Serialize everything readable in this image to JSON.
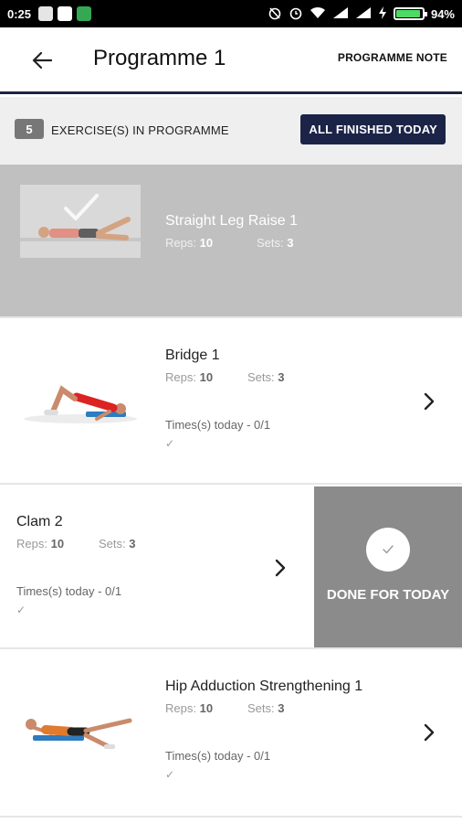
{
  "status_bar": {
    "time": "0:25",
    "battery": "94%",
    "battery_level": 0.94
  },
  "header": {
    "back_icon": "arrow-left-icon",
    "title": "Programme 1",
    "note_button": "PROGRAMME NOTE"
  },
  "summary": {
    "count": "5",
    "count_label": "EXERCISE(S) IN PROGRAMME",
    "finish_button": "ALL FINISHED TODAY"
  },
  "exercises": [
    {
      "name": "Straight Leg Raise 1",
      "reps_label": "Reps:",
      "reps": "10",
      "sets_label": "Sets:",
      "sets": "3",
      "state": "completed"
    },
    {
      "name": "Bridge 1",
      "reps_label": "Reps:",
      "reps": "10",
      "sets_label": "Sets:",
      "sets": "3",
      "times_today": "Times(s) today - 0/1"
    },
    {
      "name": "Clam 2",
      "reps_label": "Reps:",
      "reps": "10",
      "sets_label": "Sets:",
      "sets": "3",
      "times_today": "Times(s) today - 0/1",
      "swipe_action": "DONE FOR TODAY"
    },
    {
      "name": "Hip Adduction Strengthening 1",
      "reps_label": "Reps:",
      "reps": "10",
      "sets_label": "Sets:",
      "sets": "3",
      "times_today": "Times(s) today - 0/1"
    }
  ],
  "colors": {
    "primary": "#1b2447",
    "completed_row": "#c0c0c0",
    "swipe_panel": "#8b8b8b"
  }
}
